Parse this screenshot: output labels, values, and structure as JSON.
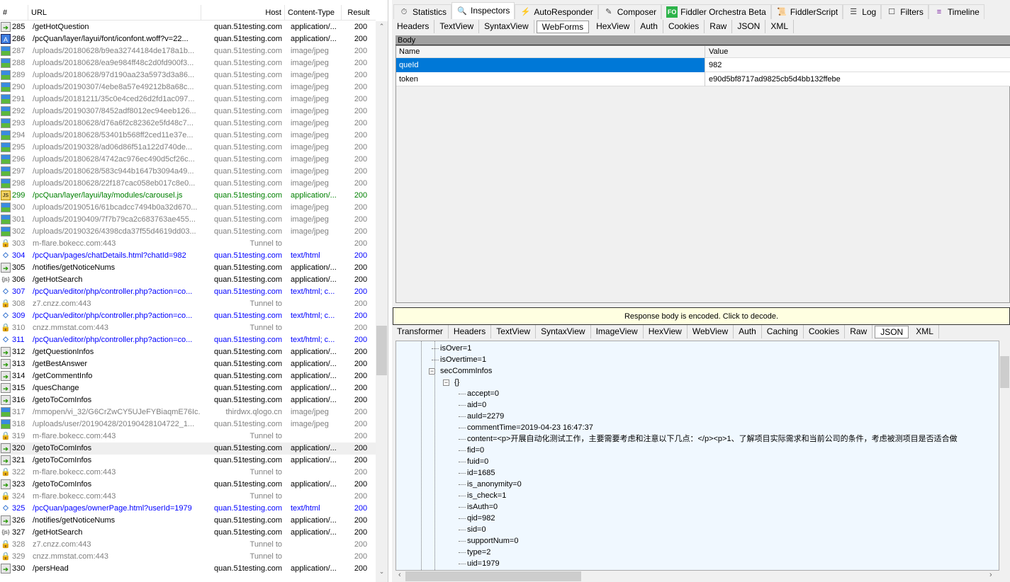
{
  "sessions": {
    "columns": {
      "num": "#",
      "url": "URL",
      "host": "Host",
      "content_type": "Content-Type",
      "result": "Result"
    },
    "rows": [
      {
        "num": "285",
        "url": "/getHotQuestion",
        "host": "quan.51testing.com",
        "ct": "application/...",
        "res": "200",
        "style": "black",
        "icon": "arrow"
      },
      {
        "num": "286",
        "url": "/pcQuan/layer/layui/font/iconfont.woff?v=22...",
        "host": "quan.51testing.com",
        "ct": "application/...",
        "res": "200",
        "style": "black",
        "icon": "font"
      },
      {
        "num": "287",
        "url": "/uploads/20180628/b9ea32744184de178a1b...",
        "host": "quan.51testing.com",
        "ct": "image/jpeg",
        "res": "200",
        "style": "gray",
        "icon": "image"
      },
      {
        "num": "288",
        "url": "/uploads/20180628/ea9e984ff48c2d0fd900f3...",
        "host": "quan.51testing.com",
        "ct": "image/jpeg",
        "res": "200",
        "style": "gray",
        "icon": "image"
      },
      {
        "num": "289",
        "url": "/uploads/20180628/97d190aa23a5973d3a86...",
        "host": "quan.51testing.com",
        "ct": "image/jpeg",
        "res": "200",
        "style": "gray",
        "icon": "image"
      },
      {
        "num": "290",
        "url": "/uploads/20190307/4ebe8a57e49212b8a68c...",
        "host": "quan.51testing.com",
        "ct": "image/jpeg",
        "res": "200",
        "style": "gray",
        "icon": "image"
      },
      {
        "num": "291",
        "url": "/uploads/20181211/35c0e4ced26d2fd1ac097...",
        "host": "quan.51testing.com",
        "ct": "image/jpeg",
        "res": "200",
        "style": "gray",
        "icon": "image"
      },
      {
        "num": "292",
        "url": "/uploads/20190307/8452adf8012ec94eeb126...",
        "host": "quan.51testing.com",
        "ct": "image/jpeg",
        "res": "200",
        "style": "gray",
        "icon": "image"
      },
      {
        "num": "293",
        "url": "/uploads/20180628/d76a6f2c82362e5fd48c7...",
        "host": "quan.51testing.com",
        "ct": "image/jpeg",
        "res": "200",
        "style": "gray",
        "icon": "image"
      },
      {
        "num": "294",
        "url": "/uploads/20180628/53401b568ff2ced11e37e...",
        "host": "quan.51testing.com",
        "ct": "image/jpeg",
        "res": "200",
        "style": "gray",
        "icon": "image"
      },
      {
        "num": "295",
        "url": "/uploads/20190328/ad06d86f51a122d740de...",
        "host": "quan.51testing.com",
        "ct": "image/jpeg",
        "res": "200",
        "style": "gray",
        "icon": "image"
      },
      {
        "num": "296",
        "url": "/uploads/20180628/4742ac976ec490d5cf26c...",
        "host": "quan.51testing.com",
        "ct": "image/jpeg",
        "res": "200",
        "style": "gray",
        "icon": "image"
      },
      {
        "num": "297",
        "url": "/uploads/20180628/583c944b1647b3094a49...",
        "host": "quan.51testing.com",
        "ct": "image/jpeg",
        "res": "200",
        "style": "gray",
        "icon": "image"
      },
      {
        "num": "298",
        "url": "/uploads/20180628/22f187cac058eb017c8e0...",
        "host": "quan.51testing.com",
        "ct": "image/jpeg",
        "res": "200",
        "style": "gray",
        "icon": "image"
      },
      {
        "num": "299",
        "url": "/pcQuan/layer/layui/lay/modules/carousel.js",
        "host": "quan.51testing.com",
        "ct": "application/...",
        "res": "200",
        "style": "green",
        "icon": "js"
      },
      {
        "num": "300",
        "url": "/uploads/20190516/61bcadcc7494b0a32d670...",
        "host": "quan.51testing.com",
        "ct": "image/jpeg",
        "res": "200",
        "style": "gray",
        "icon": "image"
      },
      {
        "num": "301",
        "url": "/uploads/20190409/7f7b79ca2c683763ae455...",
        "host": "quan.51testing.com",
        "ct": "image/jpeg",
        "res": "200",
        "style": "gray",
        "icon": "image"
      },
      {
        "num": "302",
        "url": "/uploads/20190326/4398cda37f55d4619dd03...",
        "host": "quan.51testing.com",
        "ct": "image/jpeg",
        "res": "200",
        "style": "gray",
        "icon": "image"
      },
      {
        "num": "303",
        "url": "m-flare.bokecc.com:443",
        "host": "Tunnel to",
        "ct": "",
        "res": "200",
        "style": "gray",
        "icon": "lock"
      },
      {
        "num": "304",
        "url": "/pcQuan/pages/chatDetails.html?chatId=982",
        "host": "quan.51testing.com",
        "ct": "text/html",
        "res": "200",
        "style": "blue",
        "icon": "html"
      },
      {
        "num": "305",
        "url": "/notifies/getNoticeNums",
        "host": "quan.51testing.com",
        "ct": "application/...",
        "res": "200",
        "style": "black",
        "icon": "arrow"
      },
      {
        "num": "306",
        "url": "/getHotSearch",
        "host": "quan.51testing.com",
        "ct": "application/...",
        "res": "200",
        "style": "black",
        "icon": "json"
      },
      {
        "num": "307",
        "url": "/pcQuan/editor/php/controller.php?action=co...",
        "host": "quan.51testing.com",
        "ct": "text/html; c...",
        "res": "200",
        "style": "blue",
        "icon": "html"
      },
      {
        "num": "308",
        "url": "z7.cnzz.com:443",
        "host": "Tunnel to",
        "ct": "",
        "res": "200",
        "style": "gray",
        "icon": "lock"
      },
      {
        "num": "309",
        "url": "/pcQuan/editor/php/controller.php?action=co...",
        "host": "quan.51testing.com",
        "ct": "text/html; c...",
        "res": "200",
        "style": "blue",
        "icon": "html"
      },
      {
        "num": "310",
        "url": "cnzz.mmstat.com:443",
        "host": "Tunnel to",
        "ct": "",
        "res": "200",
        "style": "gray",
        "icon": "lock"
      },
      {
        "num": "311",
        "url": "/pcQuan/editor/php/controller.php?action=co...",
        "host": "quan.51testing.com",
        "ct": "text/html; c...",
        "res": "200",
        "style": "blue",
        "icon": "html"
      },
      {
        "num": "312",
        "url": "/getQuestionInfos",
        "host": "quan.51testing.com",
        "ct": "application/...",
        "res": "200",
        "style": "black",
        "icon": "arrow"
      },
      {
        "num": "313",
        "url": "/getBestAnswer",
        "host": "quan.51testing.com",
        "ct": "application/...",
        "res": "200",
        "style": "black",
        "icon": "arrow"
      },
      {
        "num": "314",
        "url": "/getCommentInfo",
        "host": "quan.51testing.com",
        "ct": "application/...",
        "res": "200",
        "style": "black",
        "icon": "arrow"
      },
      {
        "num": "315",
        "url": "/quesChange",
        "host": "quan.51testing.com",
        "ct": "application/...",
        "res": "200",
        "style": "black",
        "icon": "arrow"
      },
      {
        "num": "316",
        "url": "/getoToComInfos",
        "host": "quan.51testing.com",
        "ct": "application/...",
        "res": "200",
        "style": "black",
        "icon": "arrow"
      },
      {
        "num": "317",
        "url": "/mmopen/vi_32/G6CrZwCY5UJeFYBiaqmE76Ic...",
        "host": "thirdwx.qlogo.cn",
        "ct": "image/jpeg",
        "res": "200",
        "style": "gray",
        "icon": "image"
      },
      {
        "num": "318",
        "url": "/uploads/user/20190428/20190428104722_1...",
        "host": "quan.51testing.com",
        "ct": "image/jpeg",
        "res": "200",
        "style": "gray",
        "icon": "image"
      },
      {
        "num": "319",
        "url": "m-flare.bokecc.com:443",
        "host": "Tunnel to",
        "ct": "",
        "res": "200",
        "style": "gray",
        "icon": "lock"
      },
      {
        "num": "320",
        "url": "/getoToComInfos",
        "host": "quan.51testing.com",
        "ct": "application/...",
        "res": "200",
        "style": "black",
        "icon": "arrow",
        "selected": true
      },
      {
        "num": "321",
        "url": "/getoToComInfos",
        "host": "quan.51testing.com",
        "ct": "application/...",
        "res": "200",
        "style": "black",
        "icon": "arrow"
      },
      {
        "num": "322",
        "url": "m-flare.bokecc.com:443",
        "host": "Tunnel to",
        "ct": "",
        "res": "200",
        "style": "gray",
        "icon": "lock"
      },
      {
        "num": "323",
        "url": "/getoToComInfos",
        "host": "quan.51testing.com",
        "ct": "application/...",
        "res": "200",
        "style": "black",
        "icon": "arrow"
      },
      {
        "num": "324",
        "url": "m-flare.bokecc.com:443",
        "host": "Tunnel to",
        "ct": "",
        "res": "200",
        "style": "gray",
        "icon": "lock"
      },
      {
        "num": "325",
        "url": "/pcQuan/pages/ownerPage.html?userId=1979",
        "host": "quan.51testing.com",
        "ct": "text/html",
        "res": "200",
        "style": "blue",
        "icon": "html"
      },
      {
        "num": "326",
        "url": "/notifies/getNoticeNums",
        "host": "quan.51testing.com",
        "ct": "application/...",
        "res": "200",
        "style": "black",
        "icon": "arrow"
      },
      {
        "num": "327",
        "url": "/getHotSearch",
        "host": "quan.51testing.com",
        "ct": "application/...",
        "res": "200",
        "style": "black",
        "icon": "json"
      },
      {
        "num": "328",
        "url": "z7.cnzz.com:443",
        "host": "Tunnel to",
        "ct": "",
        "res": "200",
        "style": "gray",
        "icon": "lock"
      },
      {
        "num": "329",
        "url": "cnzz.mmstat.com:443",
        "host": "Tunnel to",
        "ct": "",
        "res": "200",
        "style": "gray",
        "icon": "lock"
      },
      {
        "num": "330",
        "url": "/persHead",
        "host": "quan.51testing.com",
        "ct": "application/...",
        "res": "200",
        "style": "black",
        "icon": "arrow"
      }
    ]
  },
  "main_tabs": [
    {
      "label": "Statistics",
      "icon": "stopwatch"
    },
    {
      "label": "Inspectors",
      "icon": "magnifier",
      "active": true
    },
    {
      "label": "AutoResponder",
      "icon": "lightning"
    },
    {
      "label": "Composer",
      "icon": "pencil"
    },
    {
      "label": "Fiddler Orchestra Beta",
      "icon": "fo-badge",
      "badge": "FO"
    },
    {
      "label": "FiddlerScript",
      "icon": "script-js"
    },
    {
      "label": "Log",
      "icon": "document"
    },
    {
      "label": "Filters",
      "icon": "checkbox"
    },
    {
      "label": "Timeline",
      "icon": "timeline"
    }
  ],
  "request_tabs": [
    "Headers",
    "TextView",
    "SyntaxView",
    "WebForms",
    "HexView",
    "Auth",
    "Cookies",
    "Raw",
    "JSON",
    "XML"
  ],
  "request_active": "WebForms",
  "webforms": {
    "section": "Body",
    "col_name": "Name",
    "col_value": "Value",
    "rows": [
      {
        "name": "queId",
        "value": "982",
        "selected": true
      },
      {
        "name": "token",
        "value": "e90d5bf8717ad9825cb5d4bb132ffebe"
      }
    ]
  },
  "response": {
    "encoded_notice": "Response body is encoded. Click to decode.",
    "tabs": [
      "Transformer",
      "Headers",
      "TextView",
      "SyntaxView",
      "ImageView",
      "HexView",
      "WebView",
      "Auth",
      "Caching",
      "Cookies",
      "Raw",
      "JSON",
      "XML"
    ],
    "active": "JSON",
    "tree": [
      {
        "text": "isOver=1",
        "level": 1
      },
      {
        "text": "isOvertime=1",
        "level": 1
      },
      {
        "text": "secCommInfos",
        "level": 1,
        "expanded": true
      },
      {
        "text": "{}",
        "level": 2,
        "expanded": true
      },
      {
        "text": "accept=0",
        "level": 3
      },
      {
        "text": "aid=0",
        "level": 3
      },
      {
        "text": "auId=2279",
        "level": 3
      },
      {
        "text": "commentTime=2019-04-23 16:47:37",
        "level": 3
      },
      {
        "text": "content=<p>开展自动化测试工作，主要需要考虑和注意以下几点：</p><p>1、了解项目实际需求和当前公司的条件，考虑被测项目是否适合做",
        "level": 3
      },
      {
        "text": "fid=0",
        "level": 3
      },
      {
        "text": "fuid=0",
        "level": 3
      },
      {
        "text": "id=1685",
        "level": 3
      },
      {
        "text": "is_anonymity=0",
        "level": 3
      },
      {
        "text": "is_check=1",
        "level": 3
      },
      {
        "text": "isAuth=0",
        "level": 3
      },
      {
        "text": "qid=982",
        "level": 3
      },
      {
        "text": "sid=0",
        "level": 3
      },
      {
        "text": "supportNum=0",
        "level": 3
      },
      {
        "text": "type=2",
        "level": 3
      },
      {
        "text": "uid=1979",
        "level": 3
      }
    ]
  },
  "colors": {
    "selection": "#0078d7",
    "tunnel_gray": "#808080",
    "html_blue": "#0000ff",
    "js_green": "#008000",
    "notice_bg": "#ffffe1",
    "tree_bg": "#f0f8ff"
  }
}
